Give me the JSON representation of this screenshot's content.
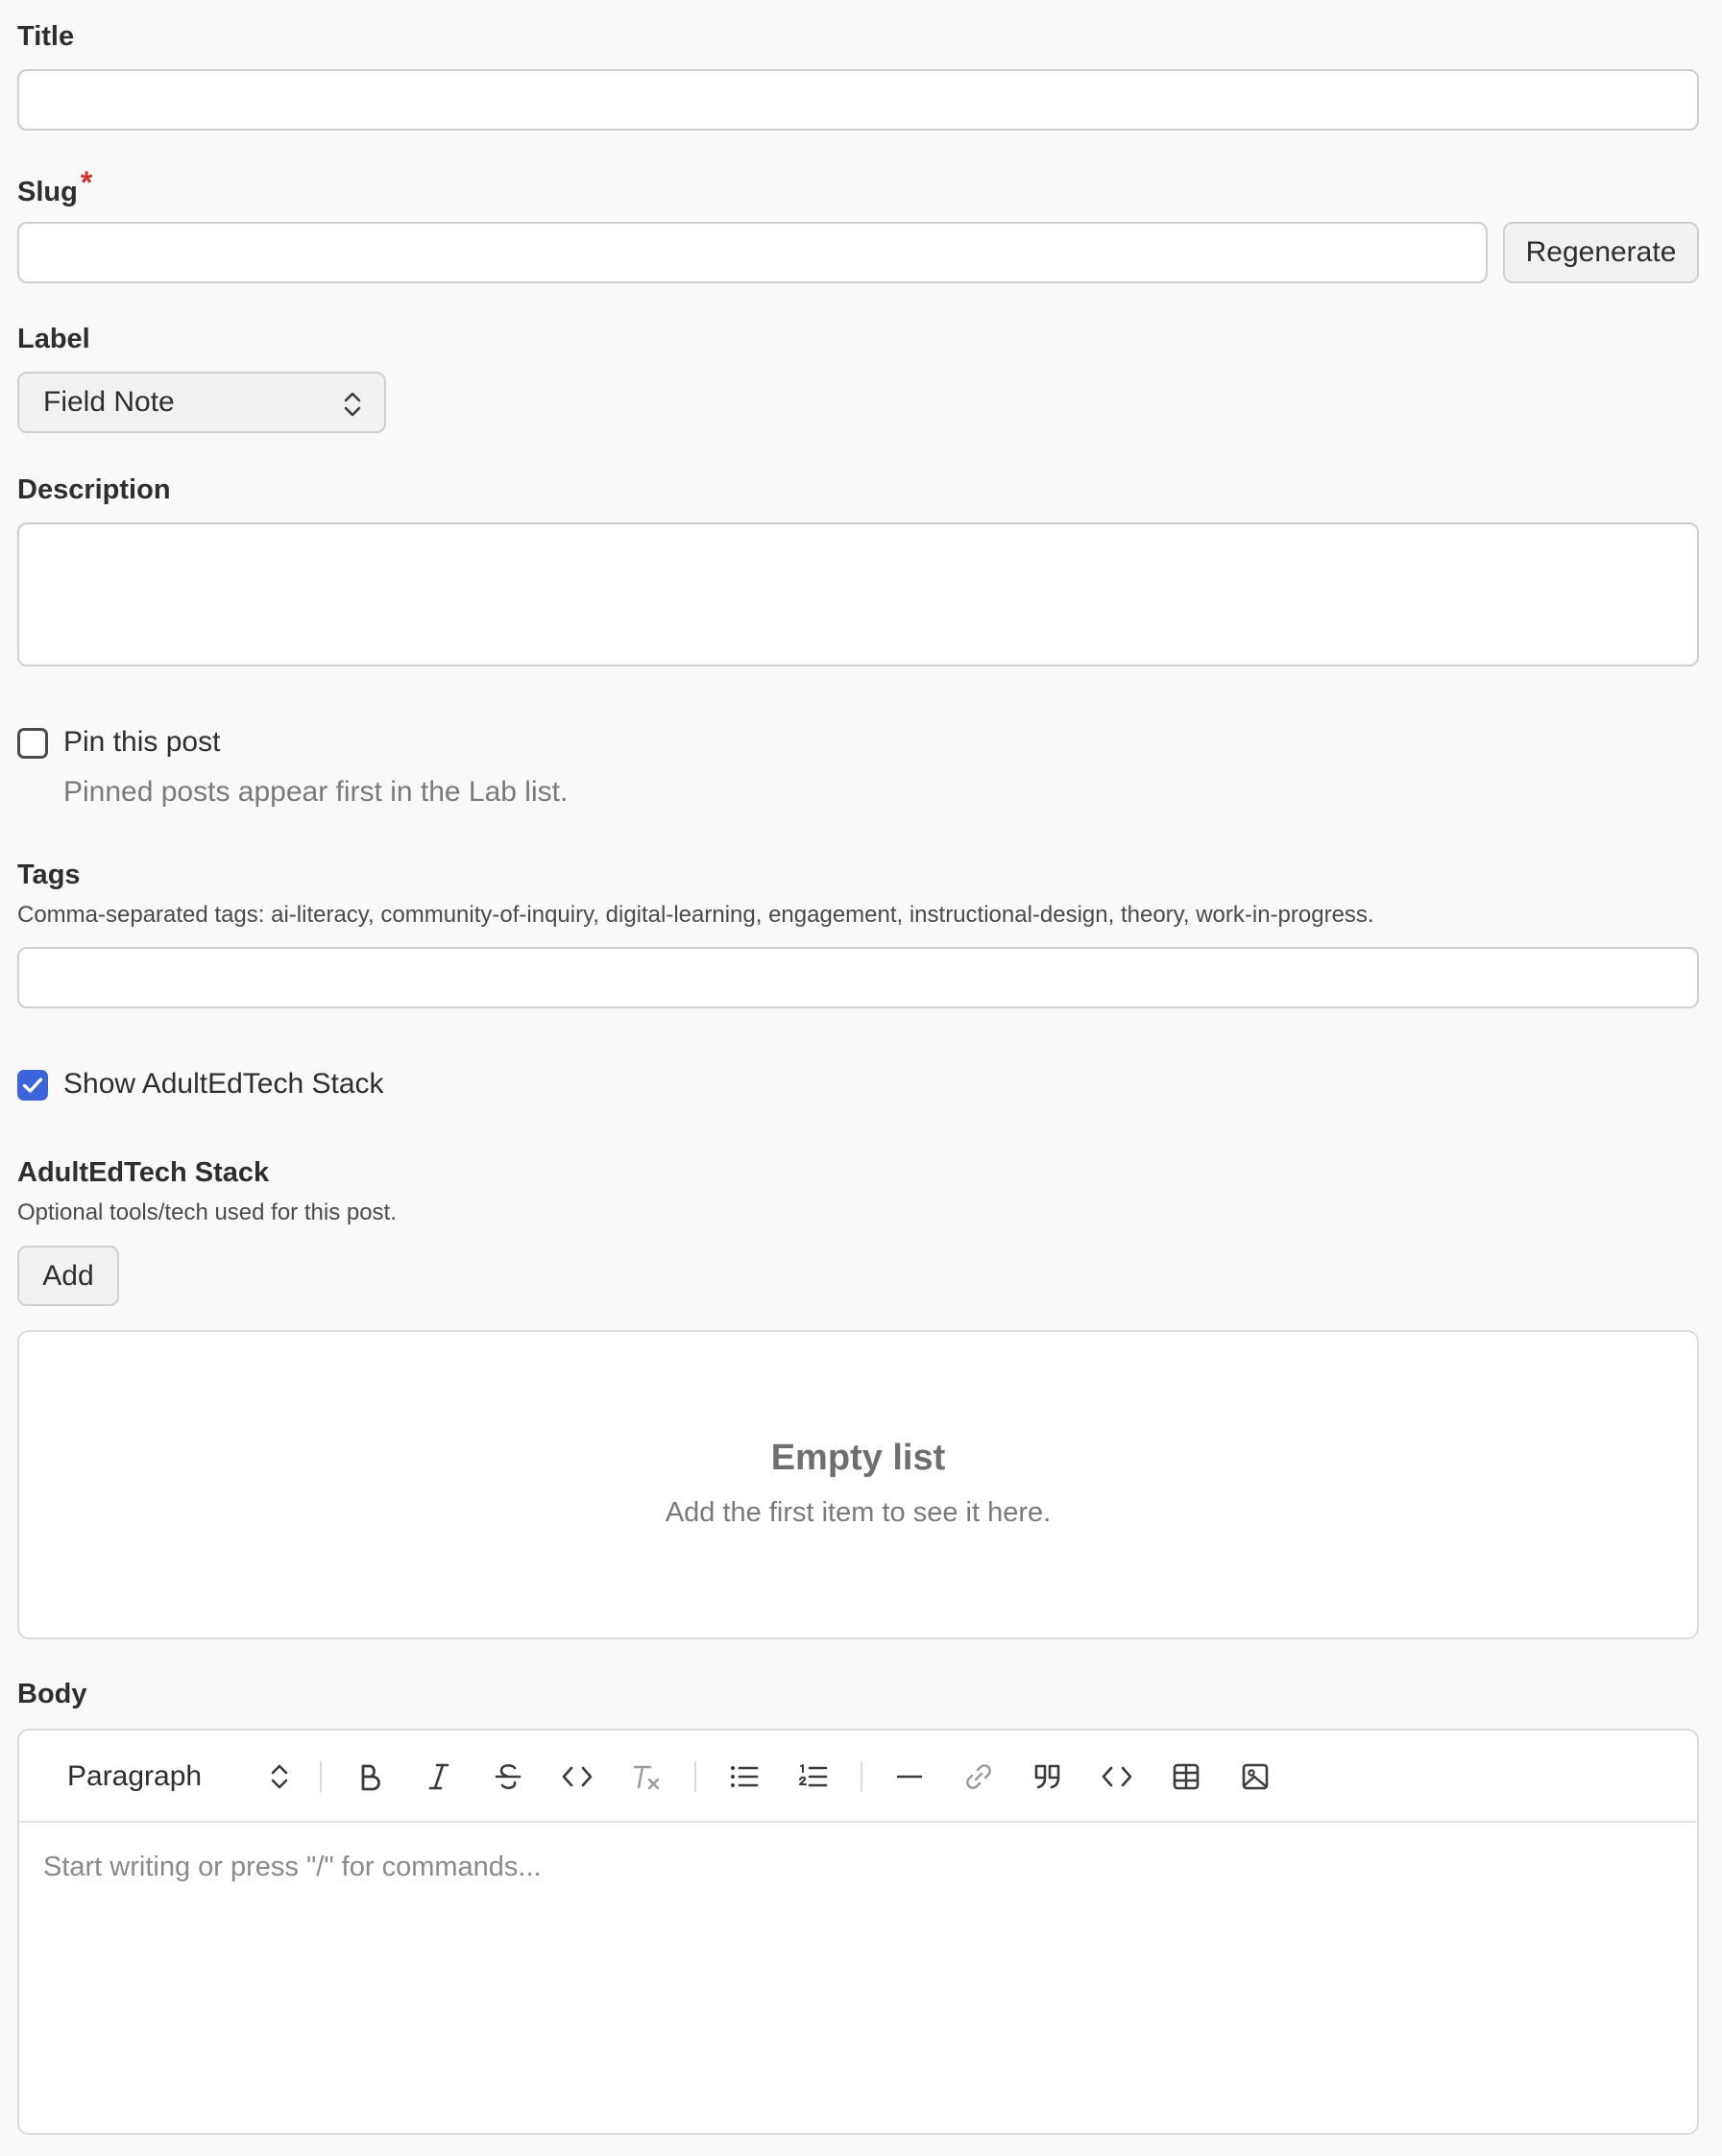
{
  "fields": {
    "title": {
      "label": "Title",
      "value": ""
    },
    "slug": {
      "label": "Slug",
      "required_mark": "*",
      "value": "",
      "regenerate_label": "Regenerate"
    },
    "label": {
      "label": "Label",
      "selected": "Field Note"
    },
    "description": {
      "label": "Description",
      "value": ""
    },
    "pin": {
      "label": "Pin this post",
      "checked": false,
      "help": "Pinned posts appear first in the Lab list."
    },
    "tags": {
      "label": "Tags",
      "help": "Comma-separated tags: ai-literacy, community-of-inquiry, digital-learning, engagement, instructional-design, theory, work-in-progress.",
      "value": ""
    },
    "show_stack": {
      "label": "Show AdultEdTech Stack",
      "checked": true
    },
    "stack": {
      "label": "AdultEdTech Stack",
      "help": "Optional tools/tech used for this post.",
      "add_label": "Add",
      "empty_title": "Empty list",
      "empty_sub": "Add the first item to see it here."
    },
    "body": {
      "label": "Body",
      "block_type": "Paragraph",
      "placeholder": "Start writing or press \"/\" for commands...",
      "toolbar_icons": [
        "bold-icon",
        "italic-icon",
        "strikethrough-icon",
        "inline-code-icon",
        "clear-format-icon",
        "bullet-list-icon",
        "ordered-list-icon",
        "horizontal-rule-icon",
        "link-icon",
        "blockquote-icon",
        "code-block-icon",
        "table-icon",
        "image-icon"
      ]
    }
  },
  "colors": {
    "accent": "#3c63d9",
    "required": "#d0302f",
    "background": "#f9f9f9"
  }
}
